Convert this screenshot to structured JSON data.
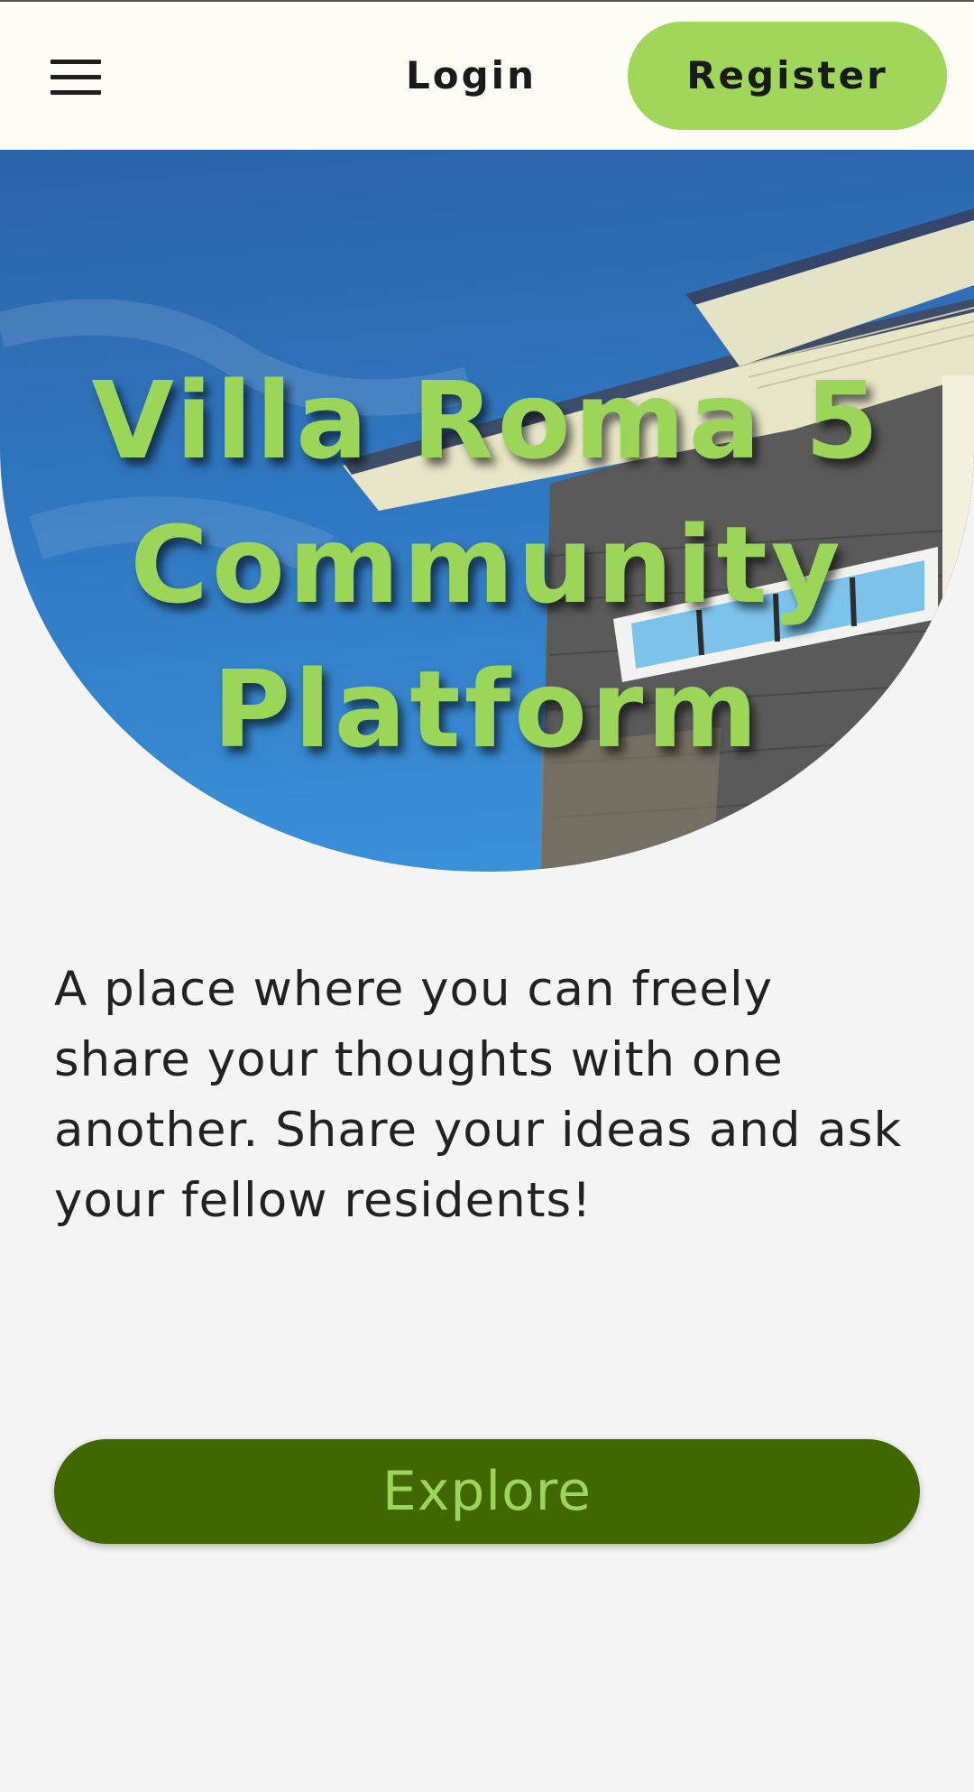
{
  "navbar": {
    "menu_icon": "hamburger-menu-icon",
    "login_label": "Login",
    "register_label": "Register"
  },
  "hero": {
    "title_line_1": "Villa Roma 5",
    "title_line_2": "Community",
    "title_line_3": "Platform"
  },
  "main": {
    "tagline": "A place where you can freely share your thoughts with one another. Share your ideas and ask your fellow residents!",
    "explore_label": "Explore"
  },
  "colors": {
    "accent_green": "#a0d65a",
    "dark_green": "#416700",
    "navbar_bg": "#fdfdf6",
    "page_bg": "#f4f4f5"
  }
}
